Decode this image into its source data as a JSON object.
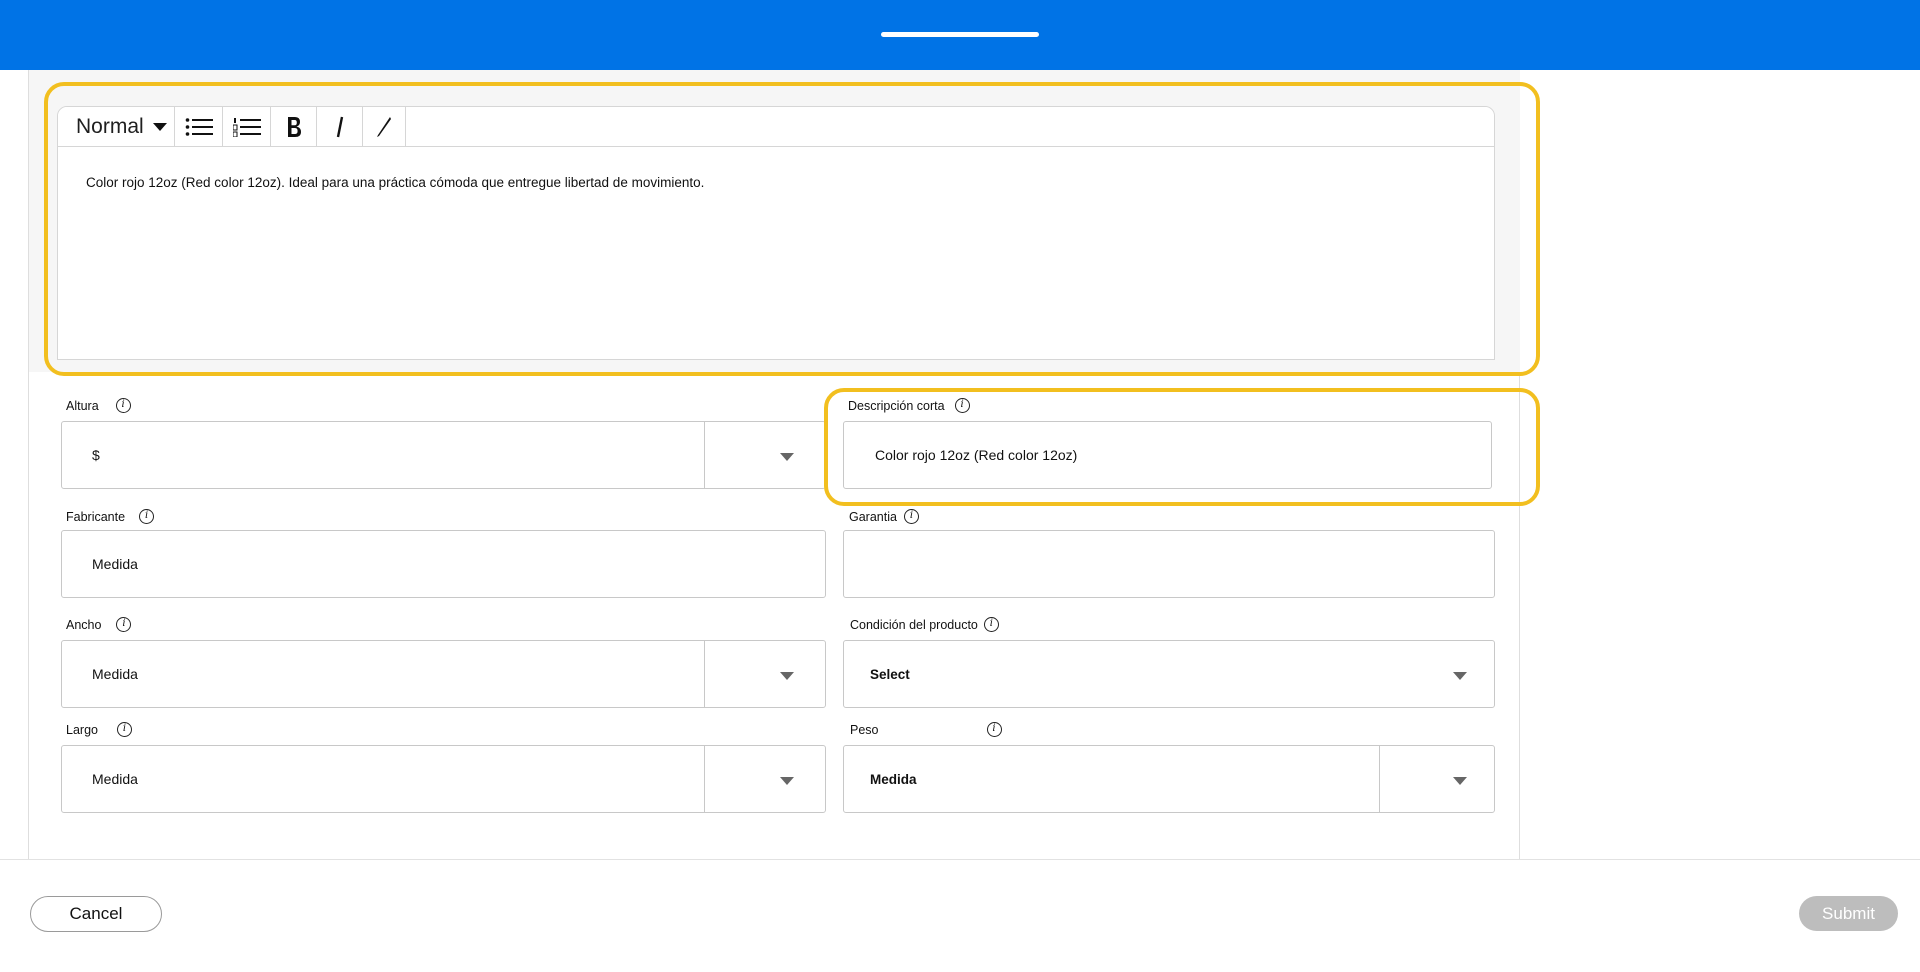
{
  "editor": {
    "format_label": "Normal",
    "body_text": "Color rojo 12oz (Red color 12oz). Ideal para una práctica cómoda que entregue libertad de movimiento."
  },
  "fields": {
    "altura": {
      "label": "Altura",
      "value": "$"
    },
    "descripcion_corta": {
      "label": "Descripción corta",
      "value": "Color rojo 12oz (Red color 12oz)"
    },
    "fabricante": {
      "label": "Fabricante",
      "value": "Medida"
    },
    "garantia": {
      "label": "Garantia",
      "value": ""
    },
    "ancho": {
      "label": "Ancho",
      "value": "Medida"
    },
    "condicion": {
      "label": "Condición del producto",
      "value": "Select"
    },
    "largo": {
      "label": "Largo",
      "value": "Medida"
    },
    "peso": {
      "label": "Peso",
      "value": "Medida"
    }
  },
  "info_glyph": "i",
  "footer": {
    "cancel_label": "Cancel",
    "submit_label": "Submit"
  },
  "colors": {
    "header": "#0073e6",
    "highlight": "#f2bf1f",
    "submit_disabled": "#bdbdbd"
  }
}
